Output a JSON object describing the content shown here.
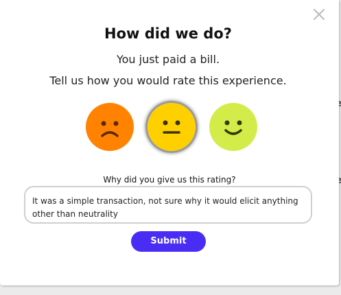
{
  "modal": {
    "title": "How did we do?",
    "subtitle_1": "You just paid a bill.",
    "subtitle_2": "Tell us how you would rate this experience.",
    "close_icon": "close-icon",
    "ratings": [
      {
        "name": "sad",
        "icon": "sad-face-icon",
        "color": "#ff8200",
        "selected": false
      },
      {
        "name": "neutral",
        "icon": "neutral-face-icon",
        "color": "#ffd000",
        "selected": true
      },
      {
        "name": "happy",
        "icon": "happy-face-icon",
        "color": "#d3ec4a",
        "selected": false
      }
    ],
    "question": "Why did you give us this rating?",
    "comment_value": "It was a simple transaction, not sure why it would elicit anything other than neutrality",
    "submit_label": "Submit",
    "accent_color": "#4a2df5"
  }
}
